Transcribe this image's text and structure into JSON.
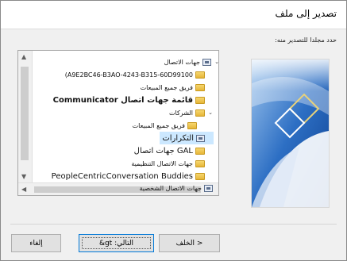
{
  "dialog": {
    "title": "تصدير إلى ملف",
    "instruction": "حدد مجلدا للتصدير منه:"
  },
  "tree": {
    "items": [
      {
        "label": "جهات الاتصال",
        "icon": "contacts-icon",
        "expander": "collapse",
        "level": 0
      },
      {
        "label": "A9E2BC46-B3AO-4243-B315-60D99100)",
        "icon": "folder-icon",
        "expander": "",
        "level": 1
      },
      {
        "label": "فريق جميع المبيعات",
        "icon": "folder-icon",
        "expander": "",
        "level": 1
      },
      {
        "label": "قائمة جهات اتصال Communicator",
        "icon": "folder-icon",
        "expander": "",
        "level": 1
      },
      {
        "label": "الشركات",
        "icon": "folder-icon",
        "expander": "collapse",
        "level": 1
      },
      {
        "label": "فريق جميع المبيعات",
        "icon": "folder-icon",
        "expander": "",
        "level": 2
      },
      {
        "label": "التكرارات",
        "icon": "contacts-icon",
        "expander": "",
        "level": 1,
        "selected": true
      },
      {
        "label": "GAL جهات اتصال",
        "icon": "folder-icon",
        "expander": "",
        "level": 1
      },
      {
        "label": "جهات الاتصال التنظيمية",
        "icon": "folder-icon",
        "expander": "",
        "level": 1
      },
      {
        "label": "PeopleCentricConversation Buddies",
        "icon": "folder-icon",
        "expander": "",
        "level": 1
      },
      {
        "label": "جهات الاتصال الشخصية",
        "icon": "contacts-icon",
        "expander": "",
        "level": 1
      }
    ]
  },
  "buttons": {
    "back": "< الخلف",
    "next": "التالي: gt&",
    "cancel": "إلغاء"
  },
  "colors": {
    "selection": "#cce8ff",
    "image_blue": "#1f5fb0"
  }
}
